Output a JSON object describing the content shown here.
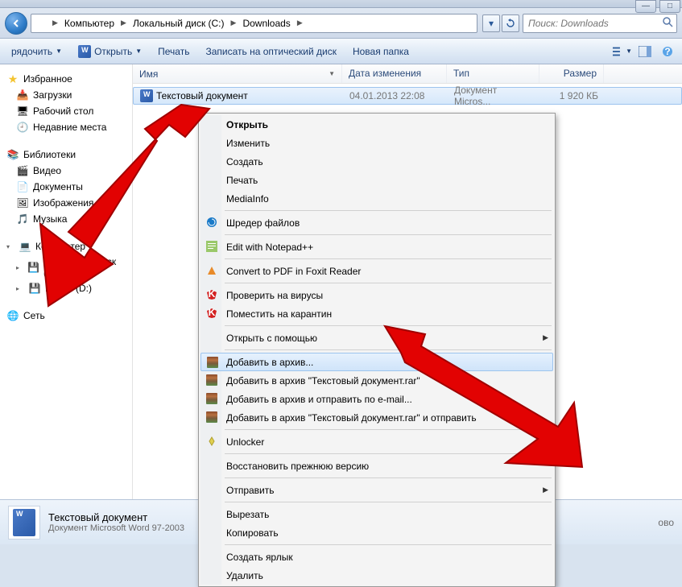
{
  "window_controls": {
    "min": "—",
    "max": "□"
  },
  "breadcrumbs": [
    "Компьютер",
    "Локальный диск (C:)",
    "Downloads"
  ],
  "search": {
    "placeholder": "Поиск: Downloads"
  },
  "toolbar": {
    "organize": "рядочить",
    "open": "Открыть",
    "print": "Печать",
    "burn": "Записать на оптический диск",
    "new_folder": "Новая папка"
  },
  "sidebar": {
    "favorites": {
      "label": "Избранное",
      "items": [
        "Загрузки",
        "Рабочий стол",
        "Недавние места"
      ]
    },
    "libraries": {
      "label": "Библиотеки",
      "items": [
        "Видео",
        "Документы",
        "Изображения",
        "Музыка"
      ]
    },
    "computer": {
      "label": "Компьютер",
      "items": [
        "Локальный диск (C:)",
        "Dimon (D:)"
      ]
    },
    "network": {
      "label": "Сеть"
    }
  },
  "columns": {
    "name": "Имя",
    "date": "Дата изменения",
    "type": "Тип",
    "size": "Размер"
  },
  "files": [
    {
      "name": "Текстовый документ",
      "date": "04.01.2013 22:08",
      "type": "Документ Micros...",
      "size": "1 920 КБ"
    }
  ],
  "context_menu": {
    "open": "Открыть",
    "edit": "Изменить",
    "new": "Создать",
    "print": "Печать",
    "mediainfo": "MediaInfo",
    "shred": "Шредер файлов",
    "npp": "Edit with Notepad++",
    "foxit": "Convert to PDF in Foxit Reader",
    "virus_check": "Проверить на вирусы",
    "quarantine": "Поместить на карантин",
    "open_with": "Открыть с помощью",
    "add_archive": "Добавить в архив...",
    "add_archive_named": "Добавить в архив \"Текстовый документ.rar\"",
    "add_email": "Добавить в архив и отправить по e-mail...",
    "add_named_email": "Добавить в архив \"Текстовый документ.rar\" и отправить",
    "unlocker": "Unlocker",
    "restore": "Восстановить прежнюю версию",
    "send_to": "Отправить",
    "cut": "Вырезать",
    "copy": "Копировать",
    "shortcut": "Создать ярлык",
    "delete": "Удалить"
  },
  "statusbar": {
    "title": "Текстовый документ",
    "subtitle": "Документ Microsoft Word 97-2003",
    "extra": "ово"
  }
}
